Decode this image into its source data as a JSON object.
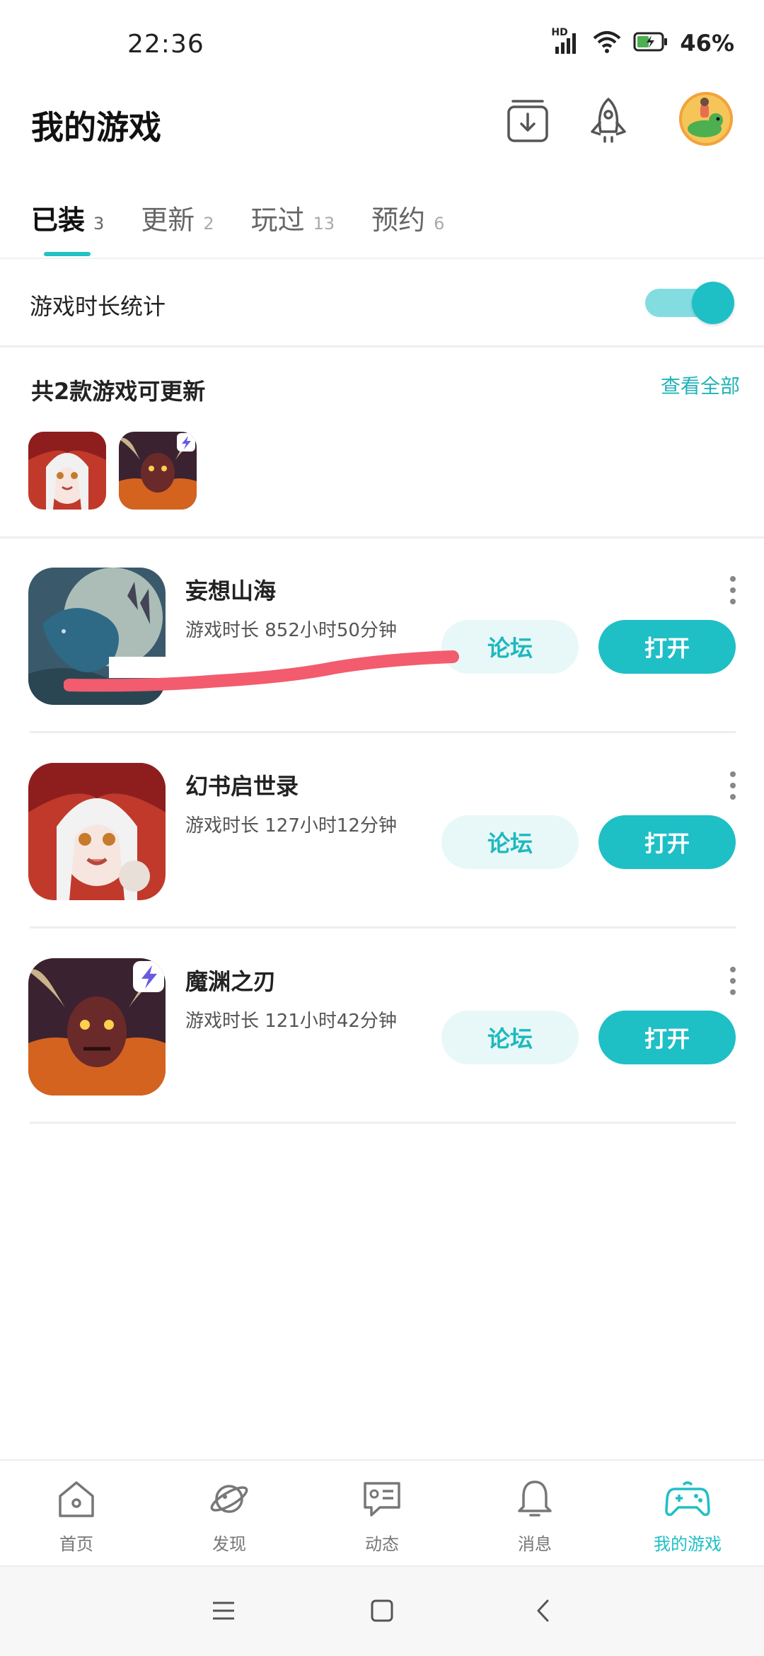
{
  "status_bar": {
    "time": "22:36",
    "battery": "46%",
    "network": "HD"
  },
  "header": {
    "title": "我的游戏"
  },
  "tabs": [
    {
      "label": "已装",
      "count": "3",
      "active": true
    },
    {
      "label": "更新",
      "count": "2",
      "active": false
    },
    {
      "label": "玩过",
      "count": "13",
      "active": false
    },
    {
      "label": "预约",
      "count": "6",
      "active": false
    }
  ],
  "playtime_toggle": {
    "label": "游戏时长统计",
    "enabled": true
  },
  "updates": {
    "title": "共2款游戏可更新",
    "view_all": "查看全部"
  },
  "games": [
    {
      "name": "妄想山海",
      "playtime": "游戏时长 852小时50分钟",
      "forum_label": "论坛",
      "open_label": "打开"
    },
    {
      "name": "幻书启世录",
      "playtime": "游戏时长 127小时12分钟",
      "forum_label": "论坛",
      "open_label": "打开"
    },
    {
      "name": "魔渊之刃",
      "playtime": "游戏时长 121小时42分钟",
      "forum_label": "论坛",
      "open_label": "打开"
    }
  ],
  "bottom_nav": [
    {
      "label": "首页",
      "icon": "home-icon",
      "active": false
    },
    {
      "label": "发现",
      "icon": "planet-icon",
      "active": false
    },
    {
      "label": "动态",
      "icon": "feed-icon",
      "active": false
    },
    {
      "label": "消息",
      "icon": "bell-icon",
      "active": false
    },
    {
      "label": "我的游戏",
      "icon": "gamepad-icon",
      "active": true
    }
  ],
  "colors": {
    "accent": "#1fbfc6",
    "accent_light": "#e8f8f9",
    "redaction": "#f25c6e"
  }
}
